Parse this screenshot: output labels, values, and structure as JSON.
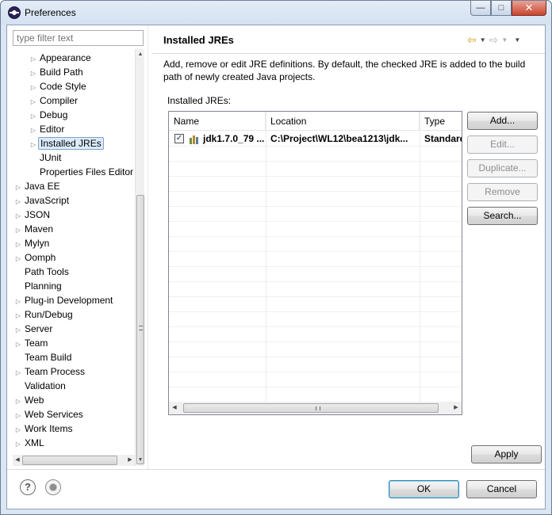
{
  "window": {
    "title": "Preferences",
    "minimize": "—",
    "maximize": "□",
    "close": "✕"
  },
  "filter": {
    "placeholder": "type filter text",
    "value": ""
  },
  "tree": {
    "items": [
      {
        "label": "Appearance",
        "expandable": true,
        "level": 2
      },
      {
        "label": "Build Path",
        "expandable": true,
        "level": 2
      },
      {
        "label": "Code Style",
        "expandable": true,
        "level": 2
      },
      {
        "label": "Compiler",
        "expandable": true,
        "level": 2
      },
      {
        "label": "Debug",
        "expandable": true,
        "level": 2
      },
      {
        "label": "Editor",
        "expandable": true,
        "level": 2
      },
      {
        "label": "Installed JREs",
        "expandable": true,
        "level": 2,
        "selected": true
      },
      {
        "label": "JUnit",
        "expandable": false,
        "level": 2
      },
      {
        "label": "Properties Files Editor",
        "expandable": false,
        "level": 2
      },
      {
        "label": "Java EE",
        "expandable": true,
        "level": 1
      },
      {
        "label": "JavaScript",
        "expandable": true,
        "level": 1
      },
      {
        "label": "JSON",
        "expandable": true,
        "level": 1
      },
      {
        "label": "Maven",
        "expandable": true,
        "level": 1
      },
      {
        "label": "Mylyn",
        "expandable": true,
        "level": 1
      },
      {
        "label": "Oomph",
        "expandable": true,
        "level": 1
      },
      {
        "label": "Path Tools",
        "expandable": false,
        "level": 1
      },
      {
        "label": "Planning",
        "expandable": false,
        "level": 1
      },
      {
        "label": "Plug-in Development",
        "expandable": true,
        "level": 1
      },
      {
        "label": "Run/Debug",
        "expandable": true,
        "level": 1
      },
      {
        "label": "Server",
        "expandable": true,
        "level": 1
      },
      {
        "label": "Team",
        "expandable": true,
        "level": 1
      },
      {
        "label": "Team Build",
        "expandable": false,
        "level": 1
      },
      {
        "label": "Team Process",
        "expandable": true,
        "level": 1
      },
      {
        "label": "Validation",
        "expandable": false,
        "level": 1
      },
      {
        "label": "Web",
        "expandable": true,
        "level": 1
      },
      {
        "label": "Web Services",
        "expandable": true,
        "level": 1
      },
      {
        "label": "Work Items",
        "expandable": true,
        "level": 1
      },
      {
        "label": "XML",
        "expandable": true,
        "level": 1
      }
    ]
  },
  "page": {
    "title": "Installed JREs",
    "description": "Add, remove or edit JRE definitions. By default, the checked JRE is added to the build path of newly created Java projects.",
    "section_label": "Installed JREs:"
  },
  "table": {
    "columns": [
      "Name",
      "Location",
      "Type"
    ],
    "rows": [
      {
        "checked": true,
        "name": "jdk1.7.0_79 ...",
        "location": "C:\\Project\\WL12\\bea1213\\jdk...",
        "type": "Standard"
      }
    ]
  },
  "buttons": {
    "add": "Add...",
    "edit": "Edit...",
    "duplicate": "Duplicate...",
    "remove": "Remove",
    "search": "Search...",
    "apply": "Apply",
    "ok": "OK",
    "cancel": "Cancel"
  },
  "icons": {
    "back": "back-arrow-icon",
    "forward": "forward-arrow-icon",
    "help": "help-icon",
    "prefs": "import-export-icon"
  },
  "colors": {
    "selection": "#dcebfc",
    "accent": "#3c7fb1",
    "back_arrow": "#d9a21b"
  }
}
